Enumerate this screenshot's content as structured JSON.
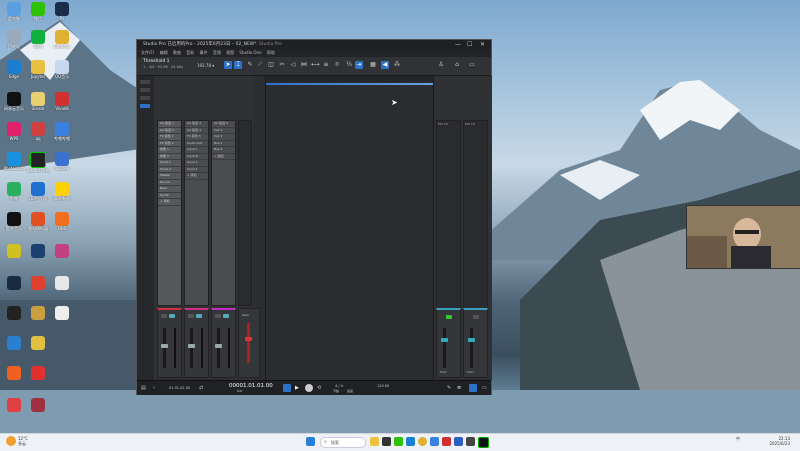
{
  "window": {
    "title": "Studio Pro 已启用的Pro - 2025年6月23日 – 02_NEW*",
    "title_right": "Studio Pro",
    "minimize": "—",
    "maximize": "☐",
    "close": "✕"
  },
  "menu": [
    "文件(F)",
    "编辑",
    "歌曲",
    "音轨",
    "事件",
    "音频",
    "视图",
    "Studio One",
    "帮助"
  ],
  "toolbar": {
    "song_name": "Threshold 1",
    "song_sub": "1 - 4/4 · 92.96 · 24 bits",
    "tempo": "192.78 ▾"
  },
  "channels": [
    {
      "name": "AA 轨道 1",
      "rows": [
        "AA 轨道 1",
        "AA 轨道 2",
        "FX 音色 1",
        "FX 音色 2",
        "效果 1",
        "效果 2",
        "Vocal 1",
        "Vocal 2",
        "Master",
        "Drums",
        "Bass",
        "Synth",
        "+ 添加"
      ]
    },
    {
      "name": "AA 轨道 2",
      "rows": [
        "AA 轨道 3",
        "AA 轨道 4",
        "FX 音色 3",
        "Audio Out",
        "Input L",
        "Input R",
        "Send 1",
        "Send 2",
        "+ 添加"
      ]
    },
    {
      "name": "AA 轨道 3",
      "rows": [
        "AA 轨道 5",
        "Inst 1",
        "Inst 2",
        "Bus 1",
        "Bus 2",
        "+ 添加"
      ]
    }
  ],
  "right_channels": [
    {
      "name": "Mix FX",
      "label": "Main"
    },
    {
      "name": "Mix FX",
      "label": "Main"
    }
  ],
  "strips": {
    "labels": [
      "S",
      "M",
      "Gain"
    ],
    "left_values": [
      "0dB",
      "0dB",
      "0dB"
    ],
    "footer": "主轨道 1"
  },
  "transport": {
    "timecode": "00001.01.01.00",
    "timecode_sub": "bar",
    "meter": "4 / 4",
    "tempo_value": "120.00",
    "bottom_left": "01.01.01.00",
    "status_a": "节拍",
    "status_b": "速度"
  },
  "desktop_icons": [
    "此电脑",
    "微信",
    "Ps",
    "回收站",
    "iQIYI",
    "Chrome",
    "Edge",
    "Jupyter",
    "QQ音乐",
    "网易云音乐",
    "Steam",
    "Vivaldi",
    "WPS",
    "qq",
    "哔哩哔哩",
    "Photoshop",
    "Studio One",
    "ToDesk",
    "剪映",
    "UU加速器",
    "网易有道",
    "酷狗音乐",
    "雷电模拟器",
    "OBS"
  ],
  "taskbar": {
    "search": "搜索",
    "weather": "12°C",
    "weather_sub": "多云",
    "time": "22:13",
    "date": "2025/6/23",
    "lang": "中"
  }
}
